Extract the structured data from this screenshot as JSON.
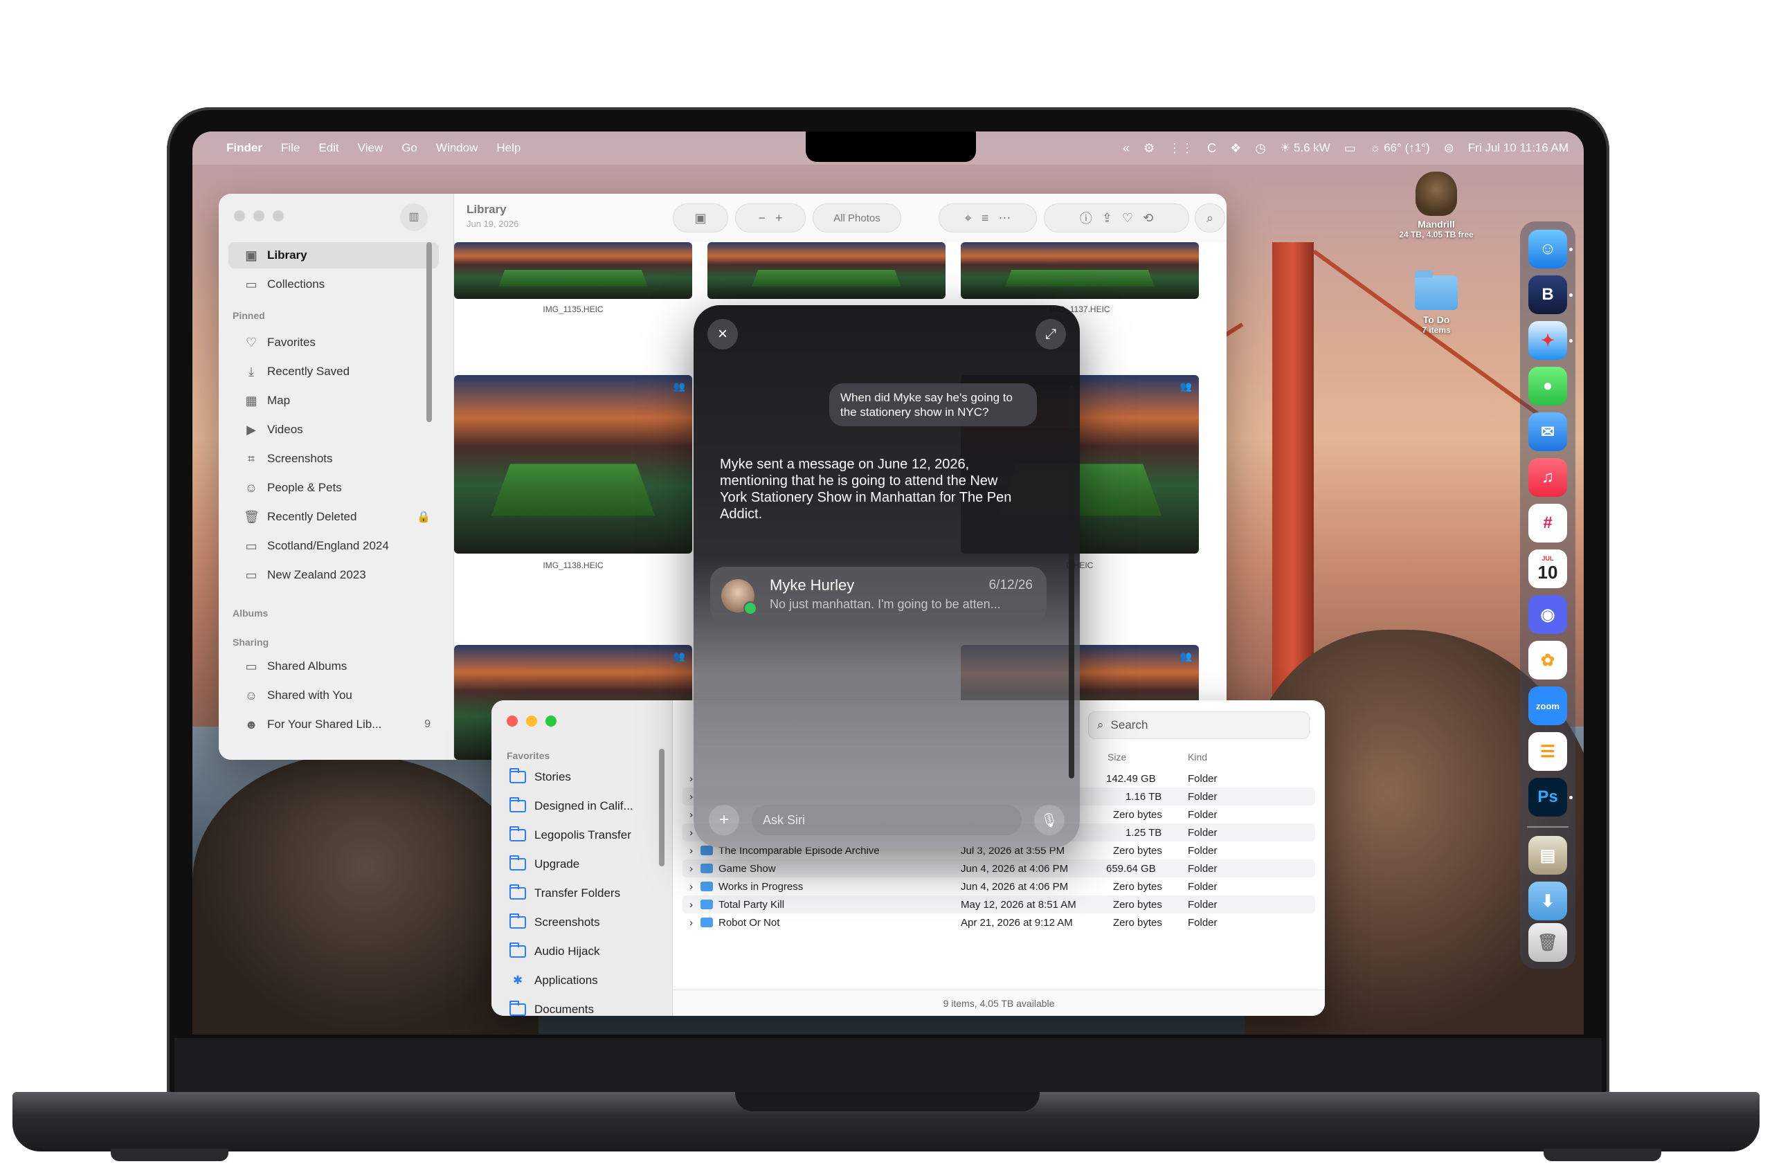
{
  "menubar": {
    "app_name": "Finder",
    "menus": [
      "File",
      "Edit",
      "View",
      "Go",
      "Window",
      "Help"
    ],
    "power": "5.6 kW",
    "weather": "66° (↑1°)",
    "datetime": "Fri Jul 10  11:16 AM"
  },
  "desktop": {
    "drive_name": "Mandrill",
    "drive_info": "24 TB, 4.05 TB free",
    "folder_name": "To Do",
    "folder_info": "7 items"
  },
  "dock": {
    "apps": [
      "finder-icon",
      "bbedit-icon",
      "safari-icon",
      "messages-icon",
      "mail-icon",
      "music-icon",
      "slack-icon",
      "calendar-icon",
      "discord-icon",
      "photos-icon",
      "zoom-icon",
      "reminders-icon",
      "photoshop-icon",
      "archive-icon",
      "downloads-folder-icon",
      "trash-icon"
    ],
    "calendar_month": "JUL",
    "calendar_day": "10",
    "zoom_label": "zoom",
    "ps_label": "Ps"
  },
  "photos": {
    "title": "Library",
    "date": "Jun 19, 2026",
    "filter": "All Photos",
    "sidebar": {
      "library": "Library",
      "collections": "Collections",
      "pinned_header": "Pinned",
      "pinned": [
        "Favorites",
        "Recently Saved",
        "Map",
        "Videos",
        "Screenshots",
        "People & Pets",
        "Recently Deleted",
        "Scotland/England 2024",
        "New Zealand 2023"
      ],
      "albums_header": "Albums",
      "sharing_header": "Sharing",
      "sharing": [
        "Shared Albums",
        "Shared with You",
        "For Your Shared Lib..."
      ],
      "shared_lib_count": "9"
    },
    "photo_labels": [
      "IMG_1135.HEIC",
      "IMG_1138.HEIC",
      "IMG_1137.HEIC",
      "0.HEIC"
    ]
  },
  "finder": {
    "sidebar_header": "Favorites",
    "sidebar_items": [
      "Stories",
      "Designed in Calif...",
      "Legopolis Transfer",
      "Upgrade",
      "Transfer Folders",
      "Screenshots",
      "Audio Hijack",
      "Applications",
      "Documents"
    ],
    "search_placeholder": "Search",
    "col_size": "Size",
    "col_kind": "Kind",
    "rows": [
      {
        "name": "",
        "date": "",
        "size": "142.49 GB",
        "kind": "Folder"
      },
      {
        "name": "",
        "date": "",
        "size": "1.16 TB",
        "kind": "Folder"
      },
      {
        "name": "",
        "date": "",
        "size": "Zero bytes",
        "kind": "Folder"
      },
      {
        "name": "",
        "date": "",
        "size": "1.25 TB",
        "kind": "Folder"
      },
      {
        "name": "The Incomparable Episode Archive",
        "date": "Jul 3, 2026 at 3:55 PM",
        "size": "Zero bytes",
        "kind": "Folder"
      },
      {
        "name": "Game Show",
        "date": "Jun 4, 2026 at 4:06 PM",
        "size": "659.64 GB",
        "kind": "Folder"
      },
      {
        "name": "Works in Progress",
        "date": "Jun 4, 2026 at 4:06 PM",
        "size": "Zero bytes",
        "kind": "Folder"
      },
      {
        "name": "Total Party Kill",
        "date": "May 12, 2026 at 8:51 AM",
        "size": "Zero bytes",
        "kind": "Folder"
      },
      {
        "name": "Robot Or Not",
        "date": "Apr 21, 2026 at 9:12 AM",
        "size": "Zero bytes",
        "kind": "Folder"
      }
    ],
    "status": "9 items, 4.05 TB available"
  },
  "siri": {
    "question": "When did Myke say he's going to the stationery show in NYC?",
    "answer": "Myke sent a message on June 12, 2026, mentioning that he is going to attend the New York Stationery Show in Manhattan for The Pen Addict.",
    "card_name": "Myke Hurley",
    "card_date": "6/12/26",
    "card_snippet": "No just manhattan. I'm going to be atten...",
    "input_placeholder": "Ask Siri"
  }
}
